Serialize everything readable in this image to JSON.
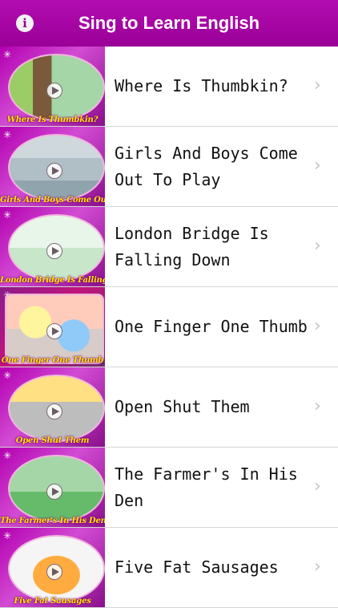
{
  "header": {
    "title": "Sing to Learn English",
    "info_icon": "i"
  },
  "songs": [
    {
      "title": "Where Is Thumbkin?",
      "thumb_caption": "Where Is Thumbkin?"
    },
    {
      "title": "Girls And Boys Come Out To Play",
      "thumb_caption": "Girls And Boys Come Out To Play"
    },
    {
      "title": "London Bridge Is Falling Down",
      "thumb_caption": "London Bridge Is Falling Down"
    },
    {
      "title": "One Finger One Thumb",
      "thumb_caption": "One Finger One Thumb"
    },
    {
      "title": "Open Shut Them",
      "thumb_caption": "Open Shut Them"
    },
    {
      "title": "The Farmer's In His Den",
      "thumb_caption": "The Farmer's In His Den"
    },
    {
      "title": "Five Fat Sausages",
      "thumb_caption": "Five Fat Sausages"
    }
  ],
  "colors": {
    "header_bg": "#a400a2",
    "thumb_bg": "#b300b0",
    "caption": "#ffe600",
    "chevron": "#c4c4c4",
    "separator": "#d6d6d6"
  },
  "icons": {
    "info": "info-icon",
    "chevron": "chevron-right-icon",
    "play": "play-icon",
    "sparkle": "sparkle-icon"
  }
}
